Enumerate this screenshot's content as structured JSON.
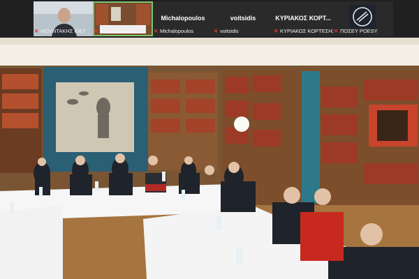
{
  "participants": [
    {
      "caption": "ΜΟΥΝΤΑΚΗΣ ΕΙΕΤ",
      "mic_muted": true,
      "type": "video"
    },
    {
      "caption": "ΠΟΣΕΥ POESY",
      "mic_muted": true,
      "type": "video",
      "active": true
    },
    {
      "name": "Michalopoulos",
      "caption": "Michalopoulos",
      "mic_muted": true,
      "type": "name"
    },
    {
      "name": "voitsidis",
      "caption": "voitsidis",
      "mic_muted": true,
      "type": "name"
    },
    {
      "name": "ΚΥΡΙΑΚΟΣ ΚΟΡΤ...",
      "caption": "ΚΥΡΙΑΚΟΣ ΚΟΡΤΕΣΗΣ",
      "mic_muted": true,
      "type": "name"
    },
    {
      "caption": "ΠΟΣΕΥ POESY",
      "mic_muted": true,
      "type": "logo"
    }
  ],
  "colors": {
    "active_border": "#7cc46a",
    "muted_mic": "#e53935",
    "strip_bg": "#202020"
  },
  "icons": {
    "muted": "mic-muted-icon",
    "logo": "poesy-logo-icon"
  }
}
